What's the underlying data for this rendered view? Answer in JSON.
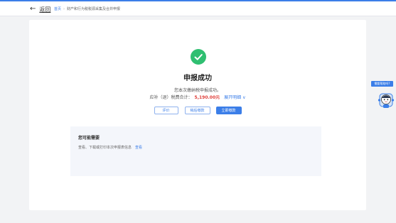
{
  "header": {
    "back_label": "返回",
    "breadcrumb": {
      "home": "首页",
      "separator": "›",
      "current": "财产和行为税税源采集及合并申报"
    }
  },
  "result": {
    "title": "申报成功",
    "message": "您本次缴纳税申报成功。",
    "tax_label": "应补（退）税费合计：",
    "tax_amount": "5,190.00元",
    "expand_label": "展开明细 ∨"
  },
  "buttons": {
    "evaluate": "评价",
    "later": "稍后缴款",
    "pay_now": "立即缴款"
  },
  "suggest": {
    "title": "您可能需要",
    "text": "查看、下载或打印本次申报表信息",
    "link": "查看"
  },
  "assistant": {
    "label": "需要帮助吗?"
  },
  "colors": {
    "accent": "#3b7ee8",
    "success": "#2fbf71",
    "amount": "#e0403b"
  },
  "icons": {
    "back": "arrow-left-icon",
    "success": "checkmark-circle-icon",
    "assistant": "robot-avatar-icon"
  }
}
